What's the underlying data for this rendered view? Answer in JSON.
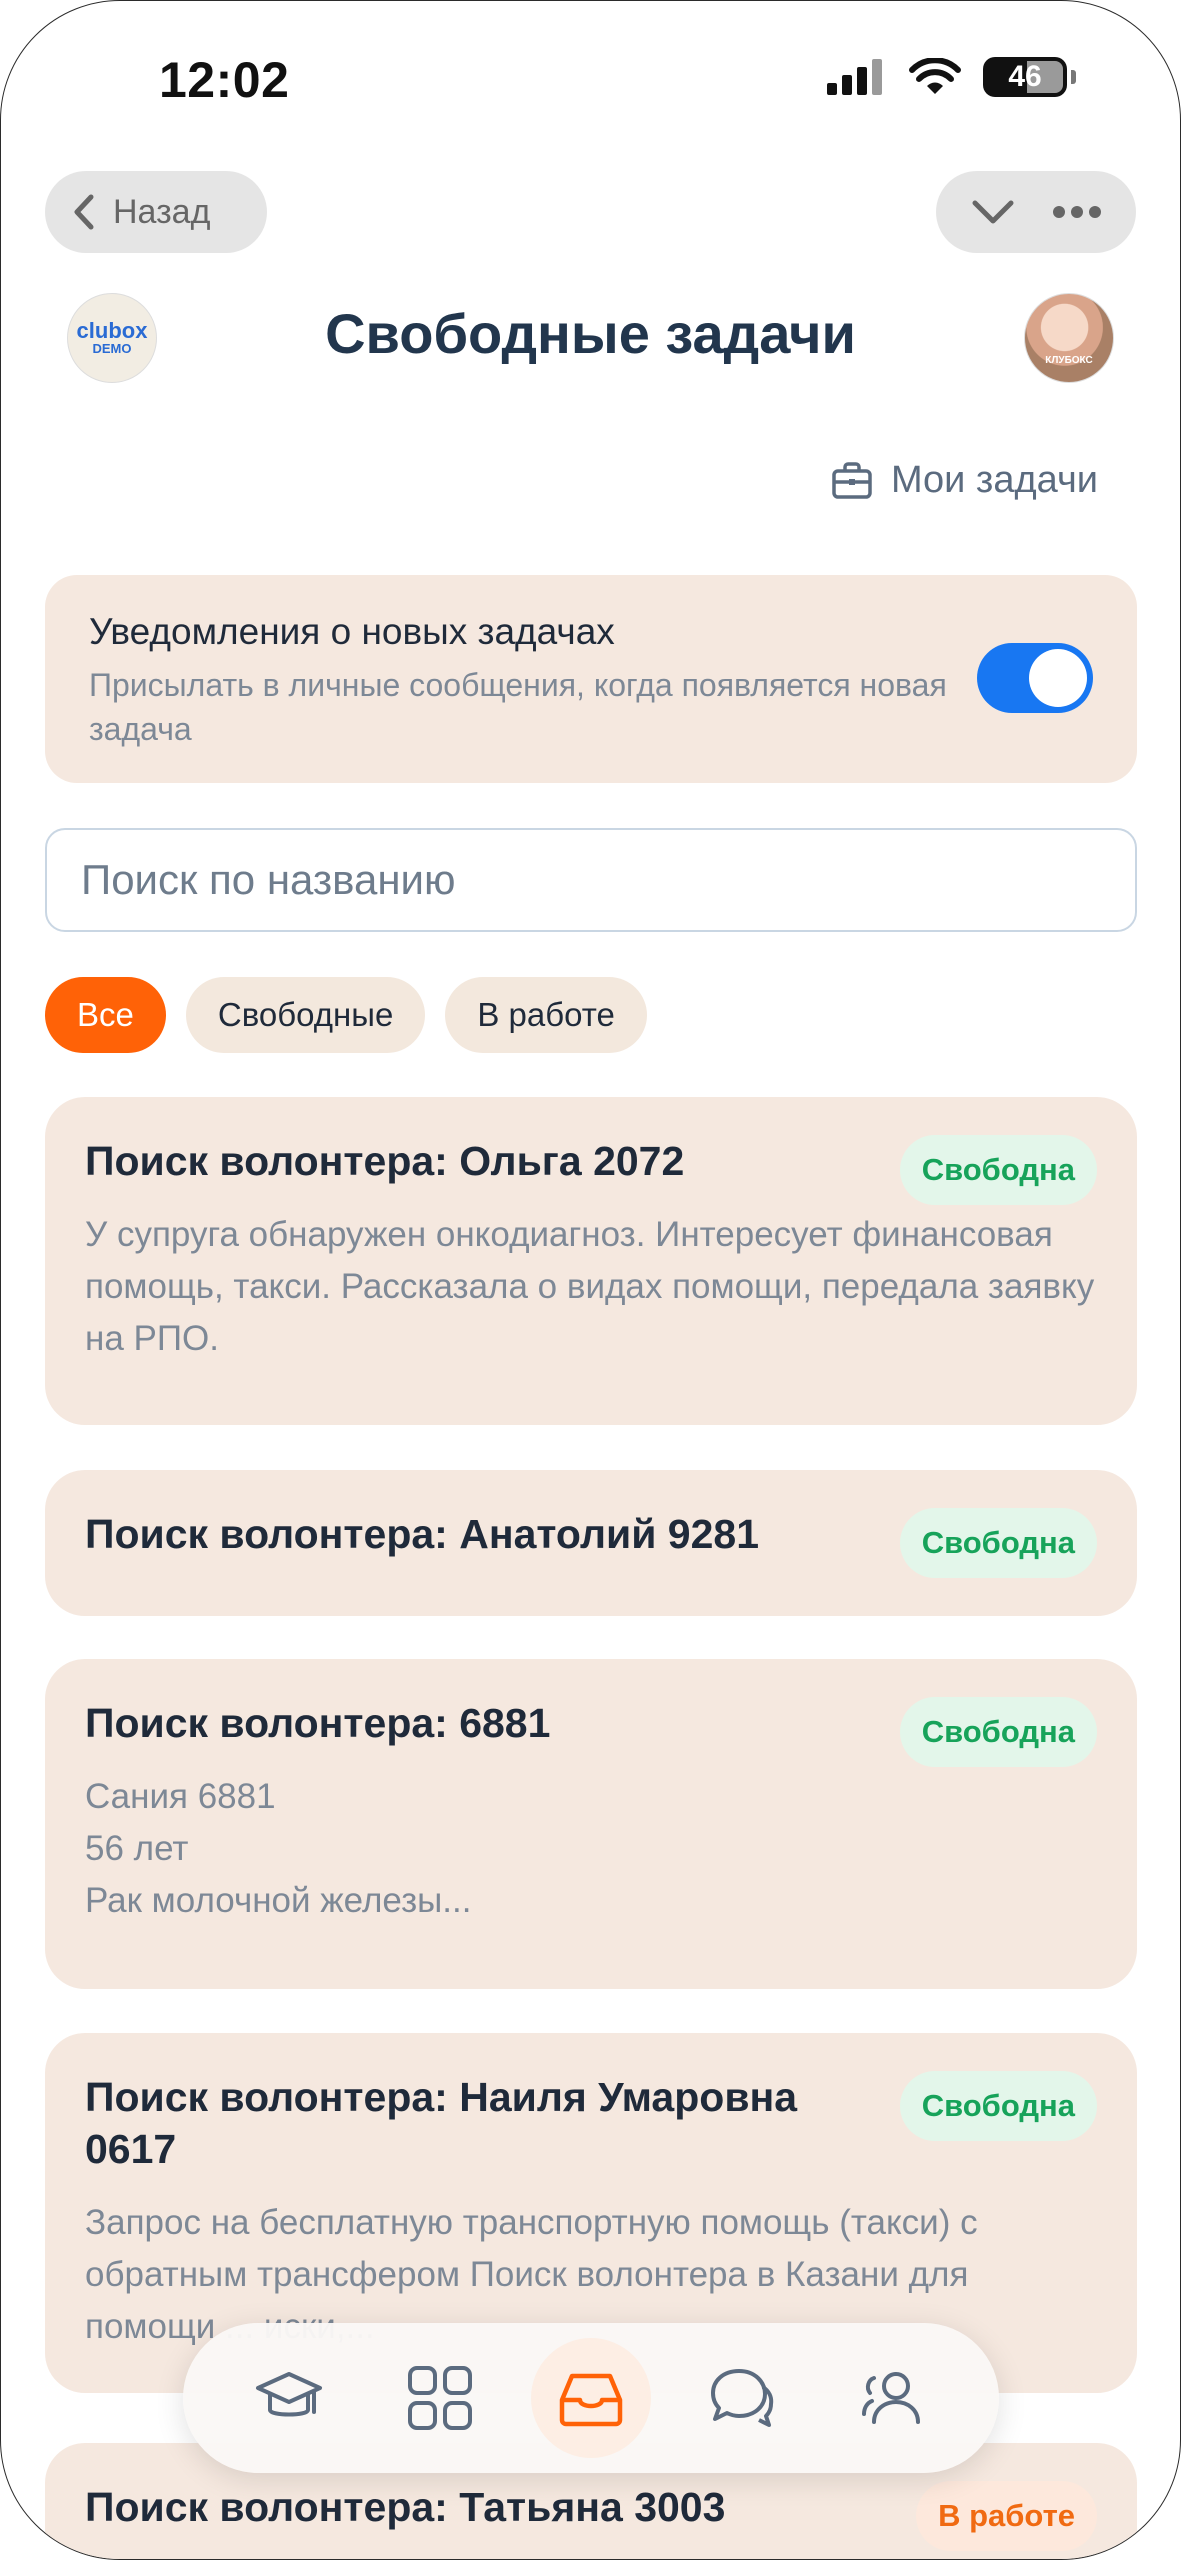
{
  "status_bar": {
    "time": "12:02",
    "battery": "46"
  },
  "nav": {
    "back_label": "Назад"
  },
  "header": {
    "logo_line1": "clubox",
    "logo_line2": "DEMO",
    "title": "Свободные задачи",
    "avatar_text": "КЛУБОКС"
  },
  "my_tasks_label": "Мои задачи",
  "notifications": {
    "title": "Уведомления о новых задачах",
    "subtitle": "Присылать в личные сообщения, когда появляется новая задача",
    "enabled": true
  },
  "search": {
    "placeholder": "Поиск по названию"
  },
  "filters": [
    {
      "label": "Все",
      "active": true
    },
    {
      "label": "Свободные",
      "active": false
    },
    {
      "label": "В работе",
      "active": false
    }
  ],
  "tasks": [
    {
      "title": "Поиск волонтера: Ольга 2072",
      "status": "Свободна",
      "description": "У супруга обнаружен онкодиагноз. Интересует финансовая помощь, такси. Рассказала о видах помощи, передала заявку на РПО."
    },
    {
      "title": "Поиск волонтера: Анатолий 9281",
      "status": "Свободна",
      "description": ""
    },
    {
      "title": "Поиск волонтера: 6881",
      "status": "Свободна",
      "description_lines": [
        "Сания 6881",
        "56 лет",
        "Рак молочной железы..."
      ]
    },
    {
      "title": "Поиск волонтера: Наиля Умаровна 0617",
      "status": "Свободна",
      "description": "Запрос на бесплатную транспортную помощь (такси) с обратным трансфером Поиск волонтера в Казани для помощи ... иски,..."
    },
    {
      "title": "Поиск волонтера: Татьяна 3003",
      "status": "В работе",
      "description": ""
    }
  ],
  "bottom_nav": [
    {
      "icon": "graduation-cap-icon",
      "active": false
    },
    {
      "icon": "grid-icon",
      "active": false
    },
    {
      "icon": "inbox-icon",
      "active": true
    },
    {
      "icon": "chat-bubbles-icon",
      "active": false
    },
    {
      "icon": "users-icon",
      "active": false
    }
  ],
  "colors": {
    "accent": "#ff6207",
    "toggle": "#1877f2",
    "card": "#f5e8df",
    "free_badge": "#17a35a",
    "work_badge": "#f06a12"
  }
}
